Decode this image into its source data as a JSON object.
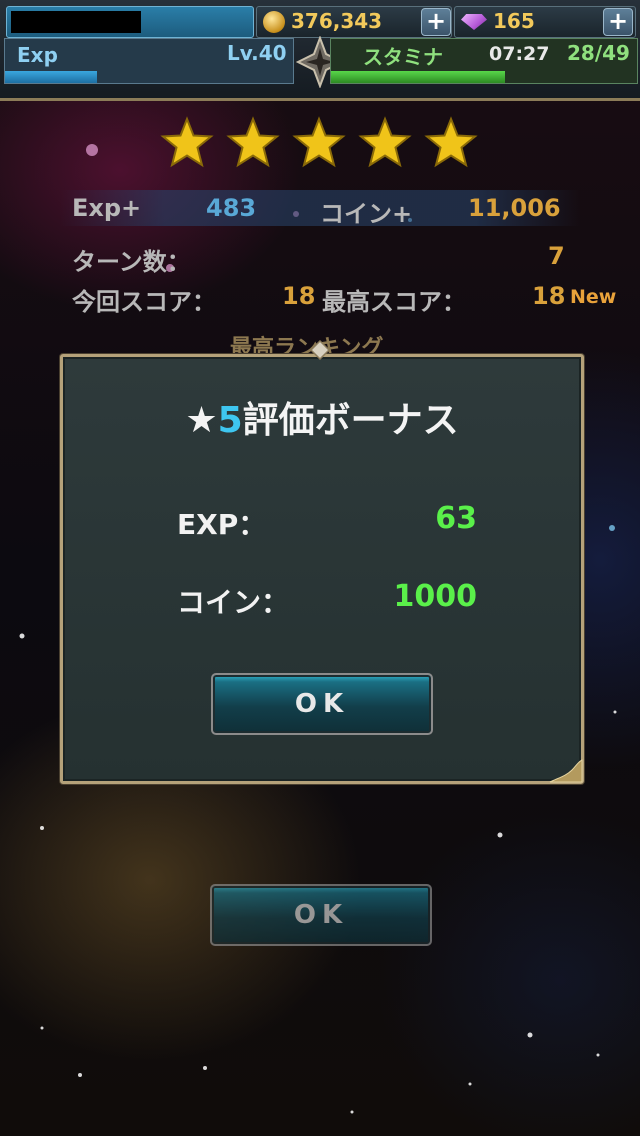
{
  "header": {
    "coins": "376,343",
    "gems": "165",
    "exp_label": "Exp",
    "level": "Lv.40",
    "stamina_label": "スタミナ",
    "stamina_time": "07:27",
    "stamina_count": "28/49",
    "exp_progress": 0.32,
    "stamina_progress": 0.57
  },
  "result": {
    "stars": 5,
    "exp_plus_label": "Exp+",
    "exp_plus_value": "483",
    "coin_plus_label": "コイン+",
    "coin_plus_value": "11,006",
    "turns_label": "ターン数：",
    "turns_value": "7",
    "score_label": "今回スコア：",
    "score_value": "18",
    "best_label": "最高スコア：",
    "best_value": "18",
    "new_tag": "New",
    "ranking_label": "最高ランキング",
    "ok_label": "OK"
  },
  "dialog": {
    "title_star": "★",
    "title_five": "5",
    "title_rest": "評価ボーナス",
    "exp_label": "EXP：",
    "exp_value": "63",
    "coin_label": "コイン：",
    "coin_value": "1000",
    "ok_label": "OK"
  }
}
